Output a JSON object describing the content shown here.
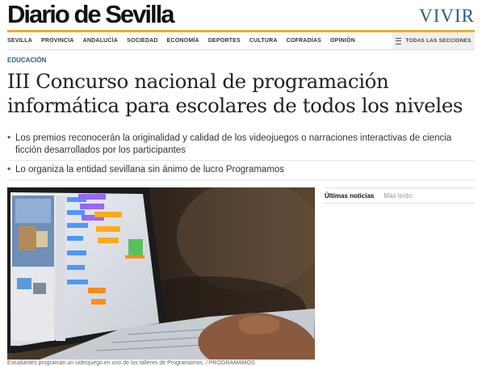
{
  "header": {
    "logo": "Diario de Sevilla",
    "section": "VIVIR"
  },
  "nav": {
    "items": [
      "Sevilla",
      "Provincia",
      "Andalucía",
      "Sociedad",
      "Economía",
      "Deportes",
      "Cultura",
      "Cofradías",
      "Opinión"
    ],
    "all_sections": "TODAS LAS SECCIONES"
  },
  "article": {
    "kicker": "EDUCACIÓN",
    "headline": "III Concurso nacional de programación informática para escolares de todos los niveles",
    "bullets": [
      "Los premios reconocerán la originalidad y calidad de los videojuegos o narraciones interactivas de ciencia ficción desarrollados por los participantes",
      "Lo organiza la entidad sevillana sin ánimo de lucro Programamos"
    ],
    "caption": "Estudiantes programan un videojuego en uno de los talleres de Programamos. / PROGRAMAMOS"
  },
  "sidebar": {
    "tabs": [
      "Últimas noticias",
      "Más leído"
    ]
  },
  "colors": {
    "accent": "#2a5c82",
    "nav_rule": "#e3b22a"
  }
}
